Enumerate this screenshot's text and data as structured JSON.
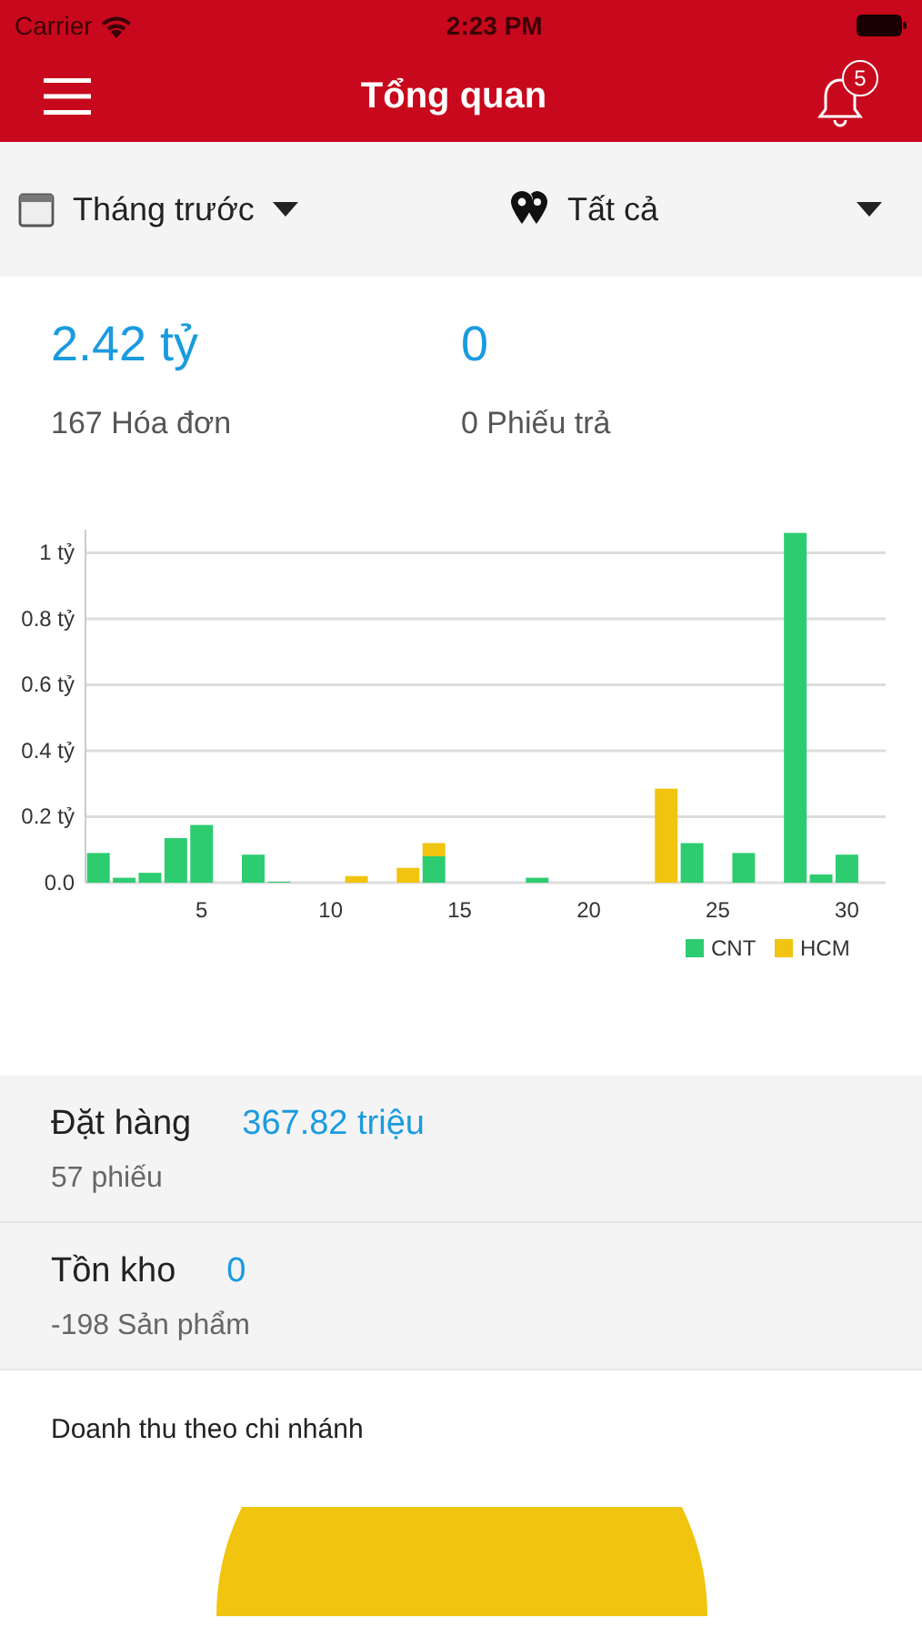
{
  "status_bar": {
    "carrier": "Carrier",
    "time": "2:23 PM"
  },
  "nav": {
    "title": "Tổng quan",
    "notification_count": "5"
  },
  "filters": [
    {
      "kind": "date",
      "label": "Tháng trước"
    },
    {
      "kind": "location",
      "label": "Tất cả"
    }
  ],
  "summary": [
    {
      "value": "2.42 tỷ",
      "caption": "167 Hóa đơn"
    },
    {
      "value": "0",
      "caption": "0 Phiếu trả"
    }
  ],
  "revenue_chart": {
    "chart_data": {
      "type": "bar",
      "stacked": true,
      "grid": true,
      "legend": true,
      "x": [
        1,
        2,
        3,
        4,
        5,
        6,
        7,
        8,
        9,
        10,
        11,
        12,
        13,
        14,
        15,
        16,
        17,
        18,
        19,
        20,
        21,
        22,
        23,
        24,
        25,
        26,
        27,
        28,
        29,
        30,
        31
      ],
      "xlim": [
        0.5,
        31.5
      ],
      "ylim": [
        0,
        1.07
      ],
      "xticks": [
        5,
        10,
        15,
        20,
        25,
        30
      ],
      "yticks": [
        {
          "value": 0,
          "label": "0.0"
        },
        {
          "value": 0.2,
          "label": "0.2 tỷ"
        },
        {
          "value": 0.4,
          "label": "0.4 tỷ"
        },
        {
          "value": 0.6,
          "label": "0.6 tỷ"
        },
        {
          "value": 0.8,
          "label": "0.8 tỷ"
        },
        {
          "value": 1,
          "label": "1 tỷ"
        }
      ],
      "series": [
        {
          "name": "CNT",
          "color": "#2ecc71",
          "values": [
            0.09,
            0.015,
            0.03,
            0.135,
            0.175,
            0,
            0.085,
            0.003,
            0,
            0,
            0,
            0,
            0,
            0.08,
            0,
            0,
            0,
            0.015,
            0,
            0,
            0,
            0,
            0,
            0.12,
            0,
            0.09,
            0,
            1.06,
            0.025,
            0.085,
            0
          ]
        },
        {
          "name": "HCM",
          "color": "#f1c40f",
          "values": [
            0,
            0,
            0,
            0,
            0,
            0,
            0,
            0,
            0,
            0,
            0.02,
            0,
            0.045,
            0.04,
            0,
            0,
            0,
            0,
            0,
            0,
            0,
            0,
            0.285,
            0,
            0,
            0,
            0,
            0,
            0,
            0,
            0
          ]
        }
      ]
    }
  },
  "details": [
    {
      "label": "Đặt hàng",
      "value": "367.82 triệu",
      "caption": "57 phiếu"
    },
    {
      "label": "Tồn kho",
      "value": "0",
      "caption": "-198 Sản phẩm"
    }
  ],
  "branch_section": {
    "title": "Doanh thu theo chi nhánh"
  }
}
